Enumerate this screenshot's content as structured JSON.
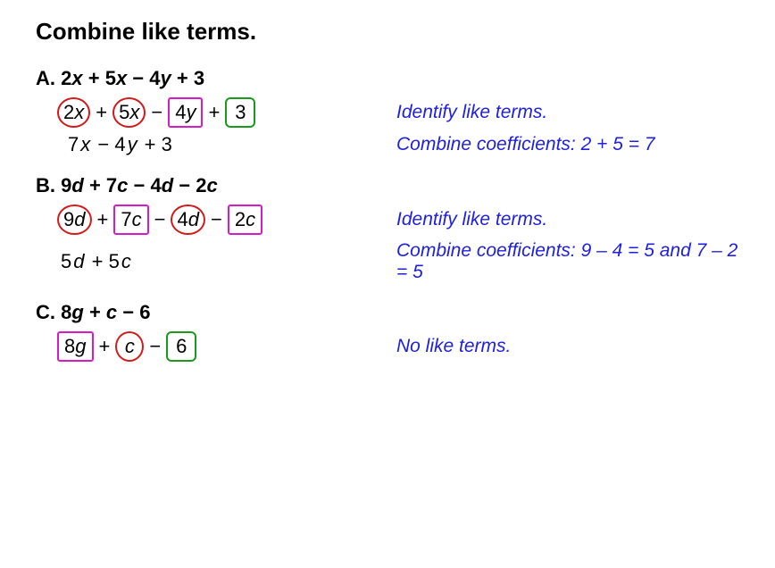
{
  "title": "Combine like terms.",
  "problems": {
    "A": {
      "label": "A.",
      "header_terms": [
        "2",
        "x",
        " + 5",
        "x",
        " − 4",
        "y",
        " + 3"
      ],
      "marked": {
        "t1": "2x",
        "op1": "+",
        "t2": "5x",
        "op2": "−",
        "t3": "4y",
        "op3": "+",
        "t4": "3"
      },
      "result": "7x − 4y + 3",
      "note1": "Identify like terms.",
      "note2": "Combine coefficients: 2 + 5 = 7"
    },
    "B": {
      "label": "B.",
      "header_terms": [
        "9",
        "d",
        " + 7",
        "c",
        " − 4",
        "d",
        " − 2",
        "c"
      ],
      "marked": {
        "t1": "9d",
        "op1": "+",
        "t2": "7c",
        "op2": "−",
        "t3": "4d",
        "op3": "−",
        "t4": "2c"
      },
      "result": "5d + 5c",
      "note1": "Identify like terms.",
      "note2": "Combine coefficients: 9 – 4 = 5 and 7 – 2 = 5"
    },
    "C": {
      "label": "C.",
      "header_terms": [
        "8",
        "g",
        " + ",
        "c",
        " − 6"
      ],
      "marked": {
        "t1": "8g",
        "op1": "+",
        "t2": "c",
        "op2": "−",
        "t3": "6"
      },
      "note1": "No like terms."
    }
  }
}
